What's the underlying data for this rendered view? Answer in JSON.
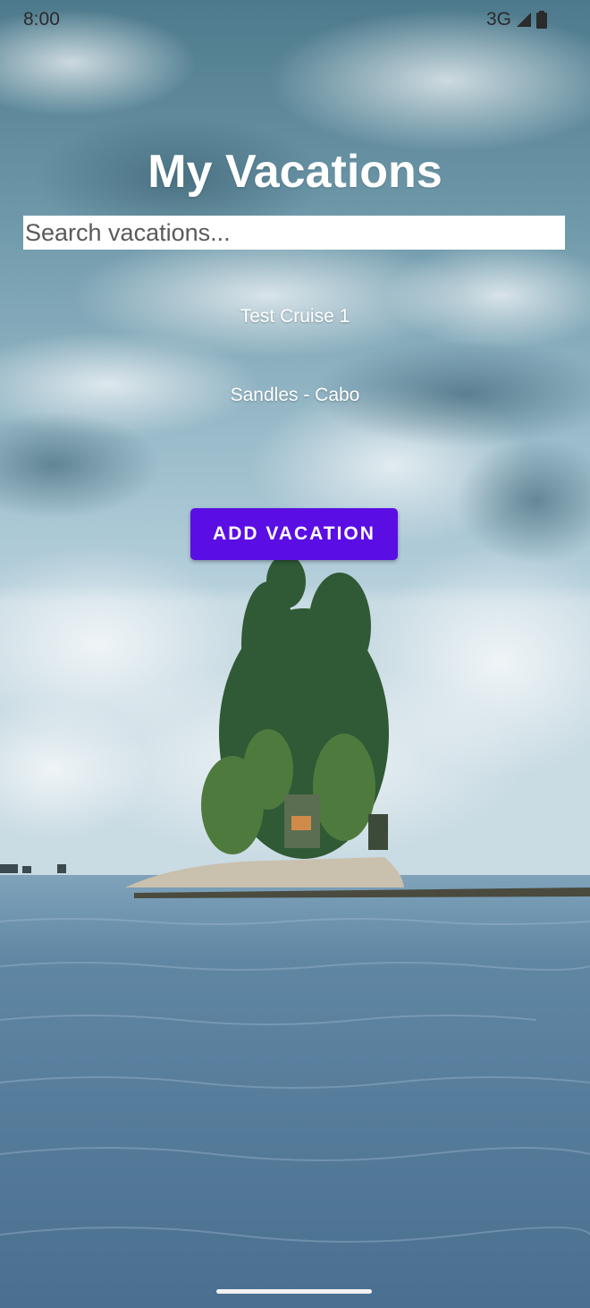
{
  "status_bar": {
    "time": "8:00",
    "network": "3G",
    "icons": [
      "signal-icon",
      "battery-icon"
    ]
  },
  "header": {
    "title": "My Vacations"
  },
  "search": {
    "placeholder": "Search vacations...",
    "value": ""
  },
  "vacations": [
    {
      "title": "Test Cruise 1"
    },
    {
      "title": "Sandles - Cabo"
    }
  ],
  "actions": {
    "add_label": "ADD VACATION"
  },
  "colors": {
    "accent": "#5a0ee4",
    "title_text": "#ffffff"
  },
  "background": {
    "scene": "tropical-island-ocean-cloudy-sky"
  }
}
